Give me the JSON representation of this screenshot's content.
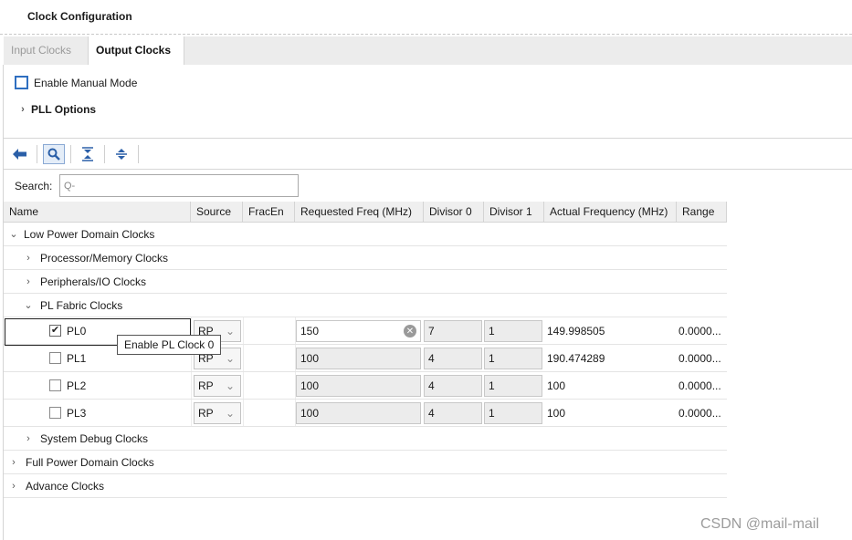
{
  "window": {
    "title": "Clock Configuration"
  },
  "tabs": [
    {
      "label": "Input Clocks",
      "active": false
    },
    {
      "label": "Output Clocks",
      "active": true
    }
  ],
  "manual_mode": {
    "label": "Enable Manual Mode",
    "checked": false
  },
  "pll_options": {
    "label": "PLL Options"
  },
  "toolbar": {
    "icons": [
      "back-icon",
      "search-icon",
      "collapse-all-icon",
      "expand-all-icon"
    ]
  },
  "search": {
    "label": "Search:",
    "placeholder": "Q-"
  },
  "columns": [
    "Name",
    "Source",
    "FracEn",
    "Requested Freq (MHz)",
    "Divisor 0",
    "Divisor 1",
    "Actual Frequency (MHz)",
    "Range"
  ],
  "tree": {
    "low_power": "Low Power Domain Clocks",
    "processor_memory": "Processor/Memory Clocks",
    "peripherals_io": "Peripherals/IO Clocks",
    "pl_fabric": "PL Fabric Clocks",
    "system_debug": "System Debug Clocks",
    "full_power": "Full Power Domain Clocks",
    "advance": "Advance Clocks"
  },
  "pl_clocks": [
    {
      "name": "PL0",
      "checked": true,
      "source": "RP",
      "requested": "150",
      "divisor0": "7",
      "divisor1": "1",
      "actual": "149.998505",
      "range": "0.0000..."
    },
    {
      "name": "PL1",
      "checked": false,
      "source": "RP",
      "requested": "100",
      "divisor0": "4",
      "divisor1": "1",
      "actual": "190.474289",
      "range": "0.0000..."
    },
    {
      "name": "PL2",
      "checked": false,
      "source": "RP",
      "requested": "100",
      "divisor0": "4",
      "divisor1": "1",
      "actual": "100",
      "range": "0.0000..."
    },
    {
      "name": "PL3",
      "checked": false,
      "source": "RP",
      "requested": "100",
      "divisor0": "4",
      "divisor1": "1",
      "actual": "100",
      "range": "0.0000..."
    }
  ],
  "tooltip": {
    "text": "Enable PL Clock 0"
  },
  "watermark": "CSDN @mail-mail",
  "colors": {
    "accent": "#2f6fc0",
    "tab_bar": "#ececec",
    "header": "#efefef"
  }
}
